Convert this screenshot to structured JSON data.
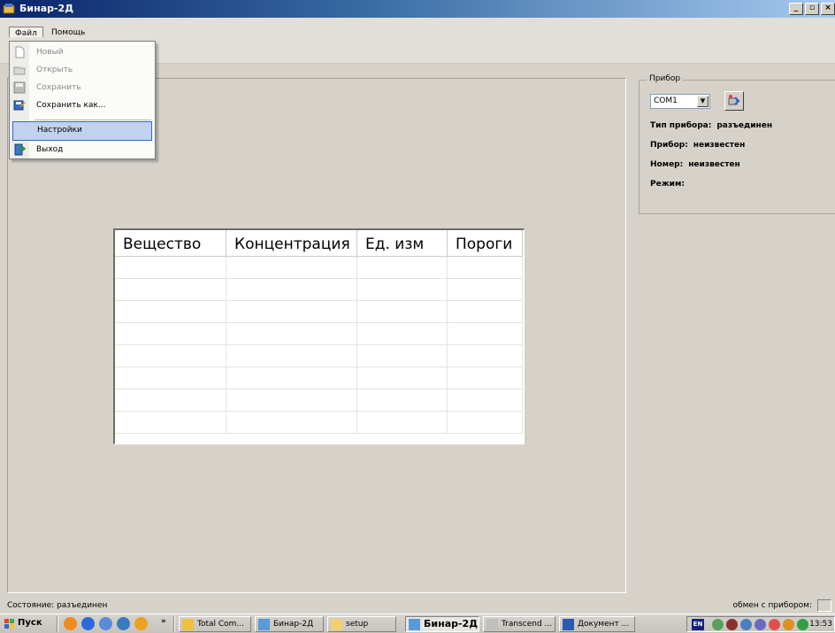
{
  "window": {
    "title": "Бинар-2Д",
    "buttons": [
      "_",
      "▫",
      "×"
    ]
  },
  "menubar": {
    "file": "Файл",
    "help": "Помощь"
  },
  "file_menu": {
    "items": [
      {
        "label": "Новый",
        "enabled": false,
        "icon": "new-file-icon"
      },
      {
        "label": "Открыть",
        "enabled": false,
        "icon": "open-folder-icon"
      },
      {
        "label": "Сохранить",
        "enabled": false,
        "icon": "save-icon"
      },
      {
        "label": "Сохранить как...",
        "enabled": true,
        "icon": "save-as-icon"
      },
      {
        "label": "Настройки",
        "enabled": true,
        "selected": true
      },
      {
        "label": "Выход",
        "enabled": true,
        "icon": "exit-icon"
      }
    ]
  },
  "device_panel": {
    "legend": "Прибор",
    "port": "COM1",
    "rows": [
      {
        "label": "Тип прибора:",
        "value": "разъединен"
      },
      {
        "label": "Прибор:",
        "value": "неизвестен"
      },
      {
        "label": "Номер:",
        "value": "неизвестен"
      },
      {
        "label": "Режим:",
        "value": ""
      }
    ]
  },
  "table": {
    "columns": [
      "Вещество",
      "Концентрация",
      "Ед. изм",
      "Пороги"
    ],
    "row_count": 8
  },
  "statusbar": {
    "left": "Состояние: разъединен",
    "right": "обмен с прибором:"
  },
  "taskbar": {
    "start": "Пуск",
    "chevron": "»",
    "buttons": [
      "Total Com...",
      "Бинар-2Д",
      "setup",
      "Бинар-2Д",
      "Transcend ...",
      "Документ ..."
    ],
    "lang": "EN",
    "clock": "13:53"
  },
  "colors": {
    "titlebar_start": "#0a246a",
    "menu_highlight": "#c1d2ee",
    "background": "#d6d2ca"
  }
}
